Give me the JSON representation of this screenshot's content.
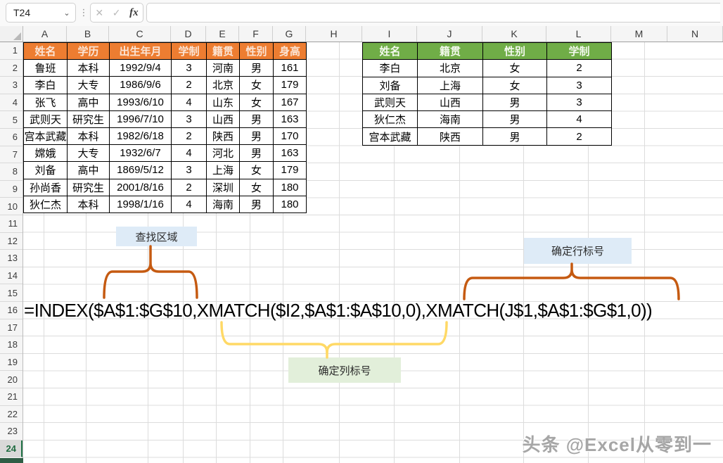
{
  "name_box": {
    "value": "T24"
  },
  "formula_bar": {
    "value": ""
  },
  "toolbar": {
    "cancel_icon": "✕",
    "enter_icon": "✓",
    "fx_icon": "fx",
    "dots_icon": "⋮",
    "chevron": "⌄"
  },
  "grid": {
    "column_letters": [
      "A",
      "B",
      "C",
      "D",
      "E",
      "F",
      "G",
      "H",
      "I",
      "J",
      "K",
      "L",
      "M",
      "N"
    ],
    "row_count": 24,
    "selected_row": 24
  },
  "left_table": {
    "headers": [
      "姓名",
      "学历",
      "出生年月",
      "学制",
      "籍贯",
      "性别",
      "身高"
    ],
    "rows": [
      [
        "鲁班",
        "本科",
        "1992/9/4",
        "3",
        "河南",
        "男",
        "161"
      ],
      [
        "李白",
        "大专",
        "1986/9/6",
        "2",
        "北京",
        "女",
        "179"
      ],
      [
        "张飞",
        "高中",
        "1993/6/10",
        "4",
        "山东",
        "女",
        "167"
      ],
      [
        "武则天",
        "研究生",
        "1996/7/10",
        "3",
        "山西",
        "男",
        "163"
      ],
      [
        "宫本武藏",
        "本科",
        "1982/6/18",
        "2",
        "陕西",
        "男",
        "170"
      ],
      [
        "嫦娥",
        "大专",
        "1932/6/7",
        "4",
        "河北",
        "男",
        "163"
      ],
      [
        "刘备",
        "高中",
        "1869/5/12",
        "3",
        "上海",
        "女",
        "179"
      ],
      [
        "孙尚香",
        "研究生",
        "2001/8/16",
        "2",
        "深圳",
        "女",
        "180"
      ],
      [
        "狄仁杰",
        "本科",
        "1998/1/16",
        "4",
        "海南",
        "男",
        "180"
      ]
    ]
  },
  "right_table": {
    "headers": [
      "姓名",
      "籍贯",
      "性别",
      "学制"
    ],
    "rows": [
      [
        "李白",
        "北京",
        "女",
        "2"
      ],
      [
        "刘备",
        "上海",
        "女",
        "3"
      ],
      [
        "武则天",
        "山西",
        "男",
        "3"
      ],
      [
        "狄仁杰",
        "海南",
        "男",
        "4"
      ],
      [
        "宫本武藏",
        "陕西",
        "男",
        "2"
      ]
    ]
  },
  "annotations": {
    "lookup_area_label": "查找区域",
    "row_number_label": "确定行标号",
    "col_number_label": "确定列标号"
  },
  "formula_text": "=INDEX($A$1:$G$10,XMATCH($I2,$A$1:$A$10,0),XMATCH(J$1,$A$1:$G$1,0))",
  "watermark": "头条 @Excel从零到一",
  "colors": {
    "left_table_header_bg": "#ED7D31",
    "right_table_header_bg": "#70AD47",
    "annotation_blue_bg": "#DEEBF7",
    "annotation_green_bg": "#E2EFDA",
    "brace_orange": "#C55A11",
    "brace_yellow": "#FFD966",
    "selection_green": "#217346"
  }
}
